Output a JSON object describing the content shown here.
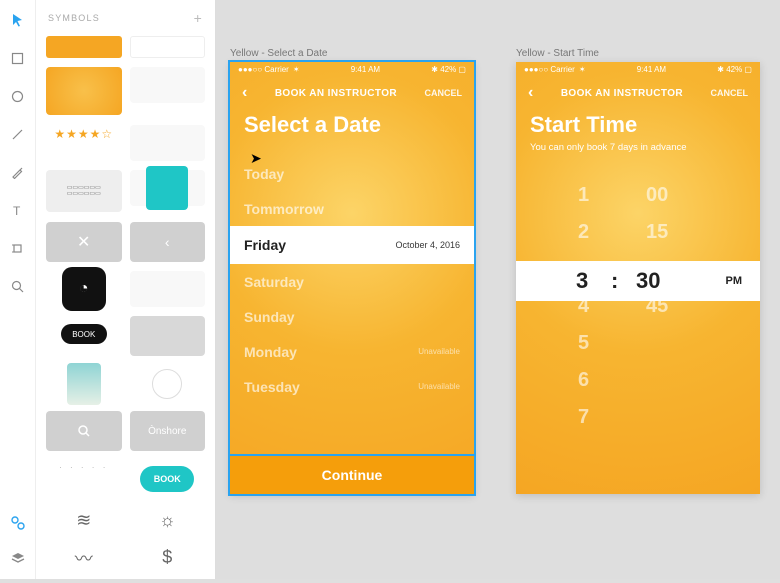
{
  "symbols_panel": {
    "title": "SYMBOLS",
    "items": {
      "stars": "★★★★☆",
      "book_pill": "BOOK",
      "onshore": "Ònshore",
      "dots": "· · · · ·",
      "book_teal": "BOOK"
    }
  },
  "artboard1": {
    "label": "Yellow - Select a Date",
    "status": {
      "carrier": "●●●○○ Carrier",
      "wifi": "✶",
      "time": "9:41 AM",
      "battery": "✱ 42% ▢"
    },
    "nav": {
      "title": "BOOK AN INSTRUCTOR",
      "cancel": "CANCEL"
    },
    "title": "Select a Date",
    "rows": [
      {
        "day": "Today",
        "detail": "",
        "selected": false,
        "unavailable": false
      },
      {
        "day": "Tommorrow",
        "detail": "",
        "selected": false,
        "unavailable": false
      },
      {
        "day": "Friday",
        "detail": "October 4, 2016",
        "selected": true,
        "unavailable": false
      },
      {
        "day": "Saturday",
        "detail": "",
        "selected": false,
        "unavailable": false
      },
      {
        "day": "Sunday",
        "detail": "",
        "selected": false,
        "unavailable": false
      },
      {
        "day": "Monday",
        "detail": "Unavailable",
        "selected": false,
        "unavailable": true
      },
      {
        "day": "Tuesday",
        "detail": "Unavailable",
        "selected": false,
        "unavailable": true
      }
    ],
    "continue": "Continue"
  },
  "artboard2": {
    "label": "Yellow - Start Time",
    "status": {
      "carrier": "●●●○○ Carrier",
      "wifi": "✶",
      "time": "9:41 AM",
      "battery": "✱ 42% ▢"
    },
    "nav": {
      "title": "BOOK AN INSTRUCTOR",
      "cancel": "CANCEL"
    },
    "title": "Start Time",
    "subtitle": "You can only book 7 days in advance",
    "hours": [
      "1",
      "2",
      "3",
      "4",
      "5",
      "6",
      "7"
    ],
    "minutes": [
      "00",
      "15",
      "30",
      "45"
    ],
    "selected": {
      "hour": "3",
      "minute": "30",
      "ampm": "PM",
      "colon": ":"
    }
  }
}
